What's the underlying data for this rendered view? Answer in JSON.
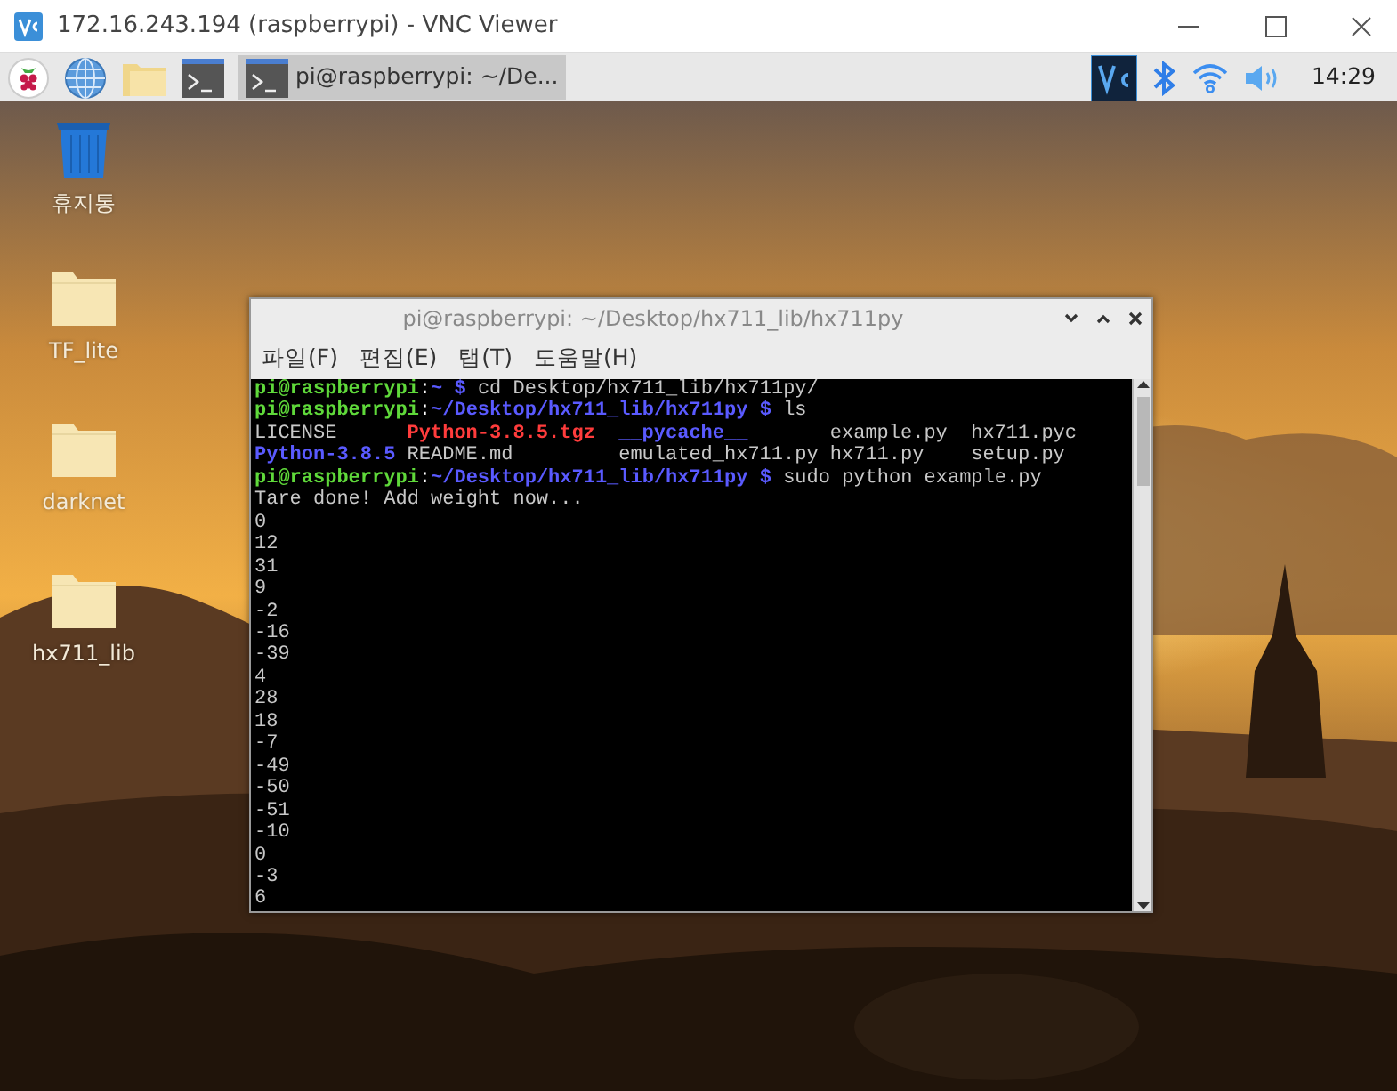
{
  "window": {
    "title": "172.16.243.194 (raspberrypi) - VNC Viewer"
  },
  "taskbar": {
    "task": {
      "label": "pi@raspberrypi: ~/De...",
      "selected": true
    },
    "clock": "14:29"
  },
  "desktop_icons": [
    {
      "kind": "trash",
      "label": "휴지통"
    },
    {
      "kind": "folder",
      "label": "TF_lite"
    },
    {
      "kind": "folder",
      "label": "darknet"
    },
    {
      "kind": "folder",
      "label": "hx711_lib"
    }
  ],
  "terminal": {
    "title": "pi@raspberrypi: ~/Desktop/hx711_lib/hx711py",
    "menu": [
      "파일(F)",
      "편집(E)",
      "탭(T)",
      "도움말(H)"
    ],
    "lines": [
      {
        "kind": "prompt",
        "user": "pi@raspberrypi",
        "sep": ":",
        "path": "~",
        "symbol": "$",
        "command": "cd Desktop/hx711_lib/hx711py/"
      },
      {
        "kind": "prompt",
        "user": "pi@raspberrypi",
        "sep": ":",
        "path": "~/Desktop/hx711_lib/hx711py",
        "symbol": "$",
        "command": "ls"
      },
      {
        "kind": "ls",
        "cells": [
          {
            "text": "LICENSE",
            "kind": "file"
          },
          {
            "text": "Python-3.8.5.tgz",
            "kind": "archive"
          },
          {
            "text": "__pycache__",
            "kind": "dir"
          },
          {
            "text": "example.py",
            "kind": "file"
          },
          {
            "text": "hx711.pyc",
            "kind": "file"
          }
        ]
      },
      {
        "kind": "ls",
        "cells": [
          {
            "text": "Python-3.8.5",
            "kind": "dir"
          },
          {
            "text": "README.md",
            "kind": "file"
          },
          {
            "text": "emulated_hx711.py",
            "kind": "file"
          },
          {
            "text": "hx711.py",
            "kind": "file"
          },
          {
            "text": "setup.py",
            "kind": "file"
          }
        ]
      },
      {
        "kind": "prompt",
        "user": "pi@raspberrypi",
        "sep": ":",
        "path": "~/Desktop/hx711_lib/hx711py",
        "symbol": "$",
        "command": "sudo python example.py"
      },
      {
        "kind": "output",
        "text": "Tare done! Add weight now..."
      },
      {
        "kind": "output",
        "text": "0"
      },
      {
        "kind": "output",
        "text": "12"
      },
      {
        "kind": "output",
        "text": "31"
      },
      {
        "kind": "output",
        "text": "9"
      },
      {
        "kind": "output",
        "text": "-2"
      },
      {
        "kind": "output",
        "text": "-16"
      },
      {
        "kind": "output",
        "text": "-39"
      },
      {
        "kind": "output",
        "text": "4"
      },
      {
        "kind": "output",
        "text": "28"
      },
      {
        "kind": "output",
        "text": "18"
      },
      {
        "kind": "output",
        "text": "-7"
      },
      {
        "kind": "output",
        "text": "-49"
      },
      {
        "kind": "output",
        "text": "-50"
      },
      {
        "kind": "output",
        "text": "-51"
      },
      {
        "kind": "output",
        "text": "-10"
      },
      {
        "kind": "output",
        "text": "0"
      },
      {
        "kind": "output",
        "text": "-3"
      },
      {
        "kind": "output",
        "text": "6"
      }
    ]
  }
}
